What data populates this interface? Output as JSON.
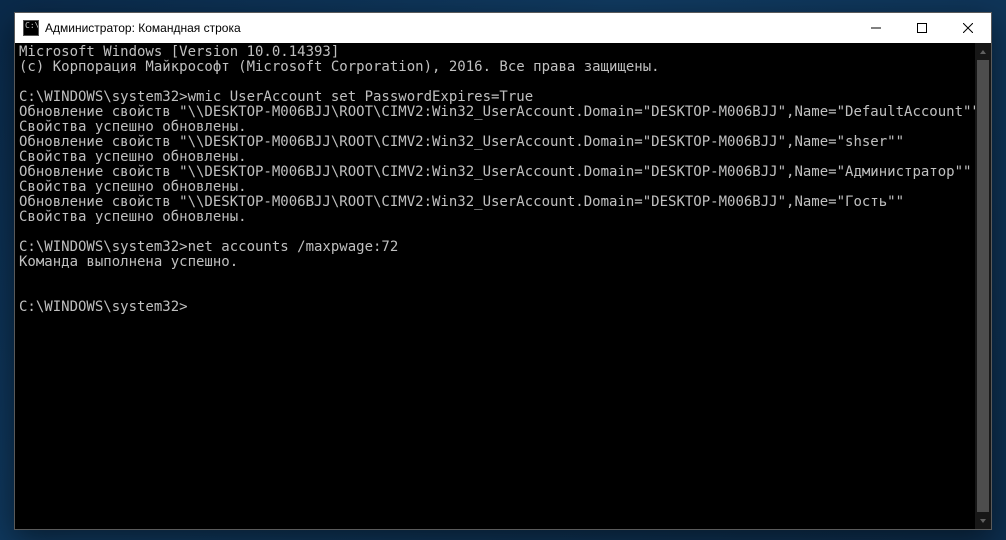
{
  "window": {
    "title": "Администратор: Командная строка"
  },
  "terminal": {
    "lines": [
      "Microsoft Windows [Version 10.0.14393]",
      "(c) Корпорация Майкрософт (Microsoft Corporation), 2016. Все права защищены.",
      "",
      "C:\\WINDOWS\\system32>wmic UserAccount set PasswordExpires=True",
      "Обновление свойств \"\\\\DESKTOP-M006BJJ\\ROOT\\CIMV2:Win32_UserAccount.Domain=\"DESKTOP-M006BJJ\",Name=\"DefaultAccount\"\"",
      "Свойства успешно обновлены.",
      "Обновление свойств \"\\\\DESKTOP-M006BJJ\\ROOT\\CIMV2:Win32_UserAccount.Domain=\"DESKTOP-M006BJJ\",Name=\"shser\"\"",
      "Свойства успешно обновлены.",
      "Обновление свойств \"\\\\DESKTOP-M006BJJ\\ROOT\\CIMV2:Win32_UserAccount.Domain=\"DESKTOP-M006BJJ\",Name=\"Администратор\"\"",
      "Свойства успешно обновлены.",
      "Обновление свойств \"\\\\DESKTOP-M006BJJ\\ROOT\\CIMV2:Win32_UserAccount.Domain=\"DESKTOP-M006BJJ\",Name=\"Гость\"\"",
      "Свойства успешно обновлены.",
      "",
      "C:\\WINDOWS\\system32>net accounts /maxpwage:72",
      "Команда выполнена успешно.",
      "",
      "",
      "C:\\WINDOWS\\system32>"
    ]
  }
}
